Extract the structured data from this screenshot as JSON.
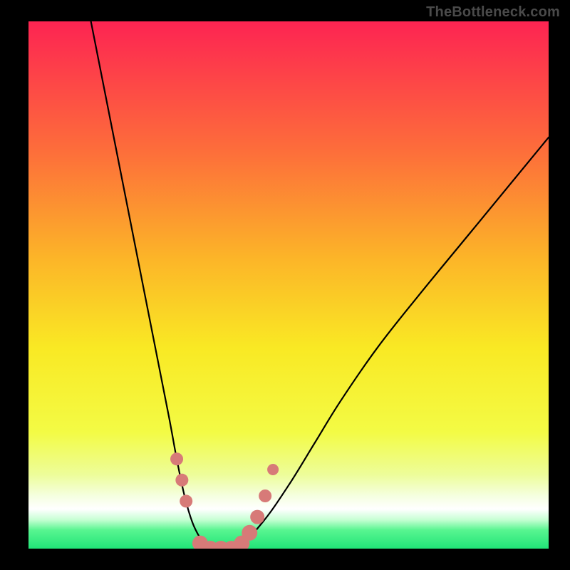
{
  "watermark": "TheBottleneck.com",
  "chart_data": {
    "type": "line",
    "title": "",
    "xlabel": "",
    "ylabel": "",
    "xlim": [
      0,
      100
    ],
    "ylim": [
      0,
      100
    ],
    "grid": false,
    "legend": false,
    "series": [
      {
        "name": "bottleneck-curve",
        "x": [
          12,
          15,
          18,
          21,
          24,
          27,
          28.5,
          30,
          31.5,
          33,
          34.5,
          36,
          40,
          45,
          50,
          55,
          60,
          67,
          75,
          85,
          95,
          100
        ],
        "values": [
          100,
          85,
          70,
          55,
          40,
          25,
          17,
          10,
          5,
          2,
          0,
          0,
          0,
          5,
          12,
          20,
          28,
          38,
          48,
          60,
          72,
          78
        ]
      }
    ],
    "markers": {
      "name": "highlight-dots",
      "color": "#d77a78",
      "points": [
        {
          "x": 28.5,
          "y": 17,
          "r": 9
        },
        {
          "x": 29.5,
          "y": 13,
          "r": 9
        },
        {
          "x": 30.3,
          "y": 9,
          "r": 9
        },
        {
          "x": 33.0,
          "y": 1,
          "r": 11
        },
        {
          "x": 35.0,
          "y": 0,
          "r": 11
        },
        {
          "x": 37.0,
          "y": 0,
          "r": 11
        },
        {
          "x": 39.0,
          "y": 0,
          "r": 11
        },
        {
          "x": 41.0,
          "y": 1,
          "r": 11
        },
        {
          "x": 42.5,
          "y": 3,
          "r": 11
        },
        {
          "x": 44.0,
          "y": 6,
          "r": 10
        },
        {
          "x": 45.5,
          "y": 10,
          "r": 9
        },
        {
          "x": 47.0,
          "y": 15,
          "r": 8
        }
      ]
    },
    "background_gradient": {
      "stops": [
        {
          "p": 0.0,
          "c": "#fd2452"
        },
        {
          "p": 0.25,
          "c": "#fd6f3a"
        },
        {
          "p": 0.45,
          "c": "#fcb528"
        },
        {
          "p": 0.62,
          "c": "#f9e924"
        },
        {
          "p": 0.78,
          "c": "#f3fb45"
        },
        {
          "p": 0.86,
          "c": "#edfd9a"
        },
        {
          "p": 0.9,
          "c": "#f5ffe0"
        },
        {
          "p": 0.925,
          "c": "#ffffff"
        },
        {
          "p": 0.945,
          "c": "#c7ffd4"
        },
        {
          "p": 0.965,
          "c": "#58f590"
        },
        {
          "p": 1.0,
          "c": "#21e478"
        }
      ]
    }
  }
}
